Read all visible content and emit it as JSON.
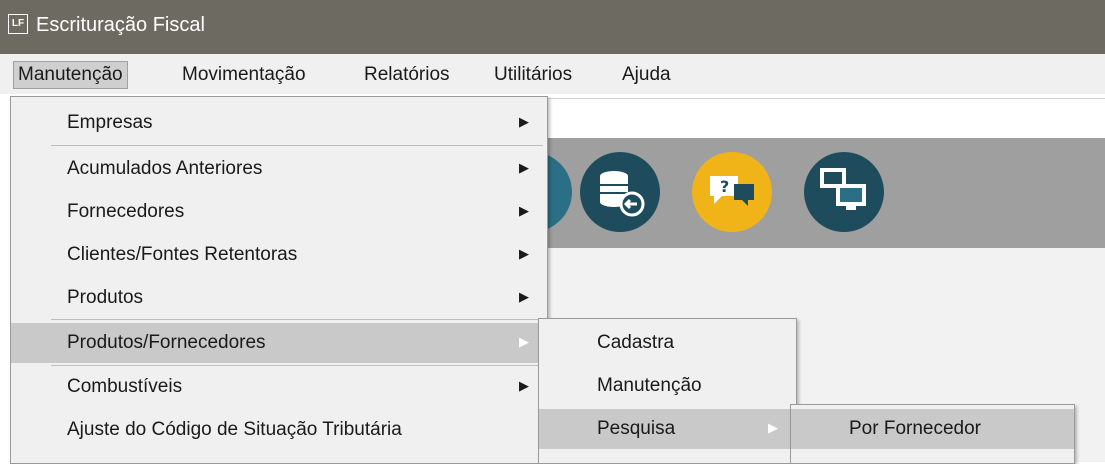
{
  "window": {
    "icon_text": "LF",
    "title": "Escrituração Fiscal"
  },
  "menubar": {
    "items": [
      {
        "label": "Manutenção"
      },
      {
        "label": "Movimentação"
      },
      {
        "label": "Relatórios"
      },
      {
        "label": "Utilitários"
      },
      {
        "label": "Ajuda"
      }
    ]
  },
  "toolbar": {
    "buttons": [
      {
        "icon": "database-back-icon",
        "color": "#1f4c5c"
      },
      {
        "icon": "help-chat-icon",
        "color": "#f0b418"
      },
      {
        "icon": "remote-monitors-icon",
        "color": "#1f4c5c"
      }
    ]
  },
  "manutencao_menu": {
    "items": [
      {
        "label": "Empresas",
        "submenu": true
      },
      {
        "label": "Acumulados Anteriores",
        "submenu": true
      },
      {
        "label": "Fornecedores",
        "submenu": true
      },
      {
        "label": "Clientes/Fontes Retentoras",
        "submenu": true
      },
      {
        "label": "Produtos",
        "submenu": true
      },
      {
        "label": "Produtos/Fornecedores",
        "submenu": true,
        "highlighted": true
      },
      {
        "label": "Combustíveis",
        "submenu": true
      },
      {
        "label": "Ajuste do Código de Situação Tributária",
        "submenu": false
      }
    ]
  },
  "produtos_fornecedores_menu": {
    "items": [
      {
        "label": "Cadastra"
      },
      {
        "label": "Manutenção"
      },
      {
        "label": "Pesquisa",
        "submenu": true,
        "highlighted": true
      }
    ]
  },
  "pesquisa_menu": {
    "items": [
      {
        "label": "Por Fornecedor",
        "highlighted": true
      }
    ]
  },
  "arrow_glyph": "▶"
}
